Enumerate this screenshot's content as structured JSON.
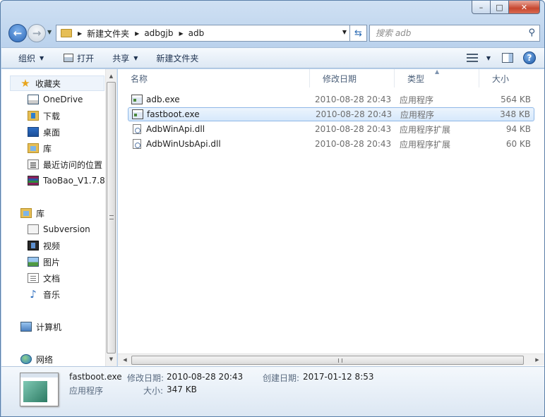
{
  "window": {
    "caption": {
      "min": "–",
      "max": "□",
      "close": "✕"
    }
  },
  "address": {
    "crumbs": [
      "新建文件夹",
      "adbgjb",
      "adb"
    ],
    "separator": "▶"
  },
  "search": {
    "placeholder": "搜索 adb"
  },
  "toolbar": {
    "organize": "组织",
    "open": "打开",
    "share": "共享",
    "new_folder": "新建文件夹"
  },
  "nav": {
    "favorites": {
      "label": "收藏夹",
      "items": [
        "OneDrive",
        "下载",
        "桌面",
        "库",
        "最近访问的位置",
        "TaoBao_V1.7.8."
      ]
    },
    "libraries": {
      "label": "库",
      "items": [
        "Subversion",
        "视频",
        "图片",
        "文档",
        "音乐"
      ]
    },
    "computer": "计算机",
    "network": "网络"
  },
  "columns": {
    "name": "名称",
    "date": "修改日期",
    "type": "类型",
    "size": "大小"
  },
  "files": [
    {
      "name": "adb.exe",
      "date": "2010-08-28 20:43",
      "type": "应用程序",
      "size": "564 KB",
      "kind": "exe"
    },
    {
      "name": "fastboot.exe",
      "date": "2010-08-28 20:43",
      "type": "应用程序",
      "size": "348 KB",
      "kind": "exe",
      "selected": true
    },
    {
      "name": "AdbWinApi.dll",
      "date": "2010-08-28 20:43",
      "type": "应用程序扩展",
      "size": "94 KB",
      "kind": "dll"
    },
    {
      "name": "AdbWinUsbApi.dll",
      "date": "2010-08-28 20:43",
      "type": "应用程序扩展",
      "size": "60 KB",
      "kind": "dll"
    }
  ],
  "details": {
    "name": "fastboot.exe",
    "type": "应用程序",
    "modified_label": "修改日期:",
    "modified": "2010-08-28 20:43",
    "created_label": "创建日期:",
    "created": "2017-01-12 8:53",
    "size_label": "大小:",
    "size": "347 KB"
  }
}
